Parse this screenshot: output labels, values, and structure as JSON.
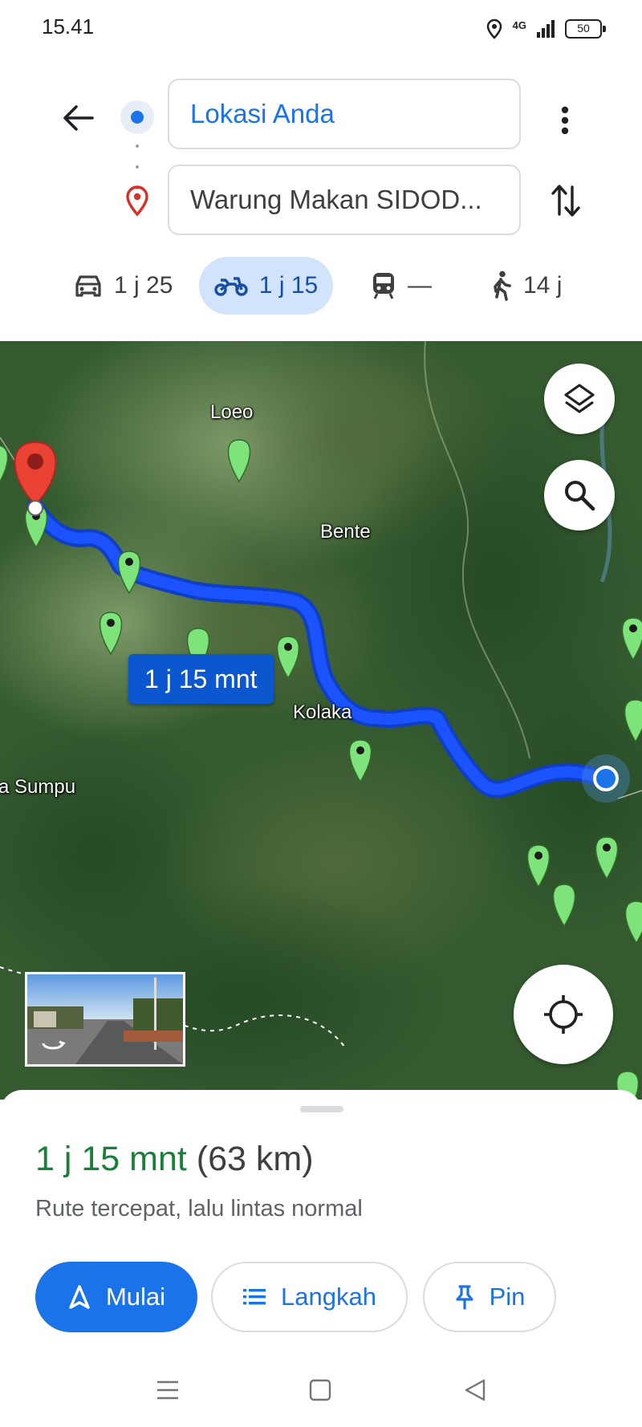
{
  "status_bar": {
    "time": "15.41",
    "network": "4G",
    "battery": "50"
  },
  "route": {
    "origin": "Lokasi Anda",
    "destination": "Warung Makan SIDOD...",
    "modes": [
      {
        "name": "car",
        "icon": "car-icon",
        "label": "1 j 25",
        "selected": false
      },
      {
        "name": "motorcycle",
        "icon": "motorcycle-icon",
        "label": "1 j 15",
        "selected": true
      },
      {
        "name": "transit",
        "icon": "train-icon",
        "label": "—",
        "selected": false
      },
      {
        "name": "walk",
        "icon": "walking-icon",
        "label": "14 j",
        "selected": false
      }
    ]
  },
  "map": {
    "labels": {
      "loeo": "Loeo",
      "bente": "Bente",
      "kolaka": "Kolaka",
      "sumpu": "a Sumpu"
    },
    "route_time": "1 j 15 mnt",
    "route_color": "#1a53ff",
    "destination_marker_color": "#d93025",
    "poi_marker_color": "#7ee37a"
  },
  "sheet": {
    "duration": "1 j 15 mnt",
    "distance": "(63 km)",
    "description": "Rute tercepat, lalu lintas normal",
    "buttons": {
      "start": "Mulai",
      "steps": "Langkah",
      "pin": "Pin"
    }
  },
  "colors": {
    "accent": "#1a73e8",
    "duration_green": "#188038",
    "selected_mode_bg": "#d2e3fc"
  }
}
